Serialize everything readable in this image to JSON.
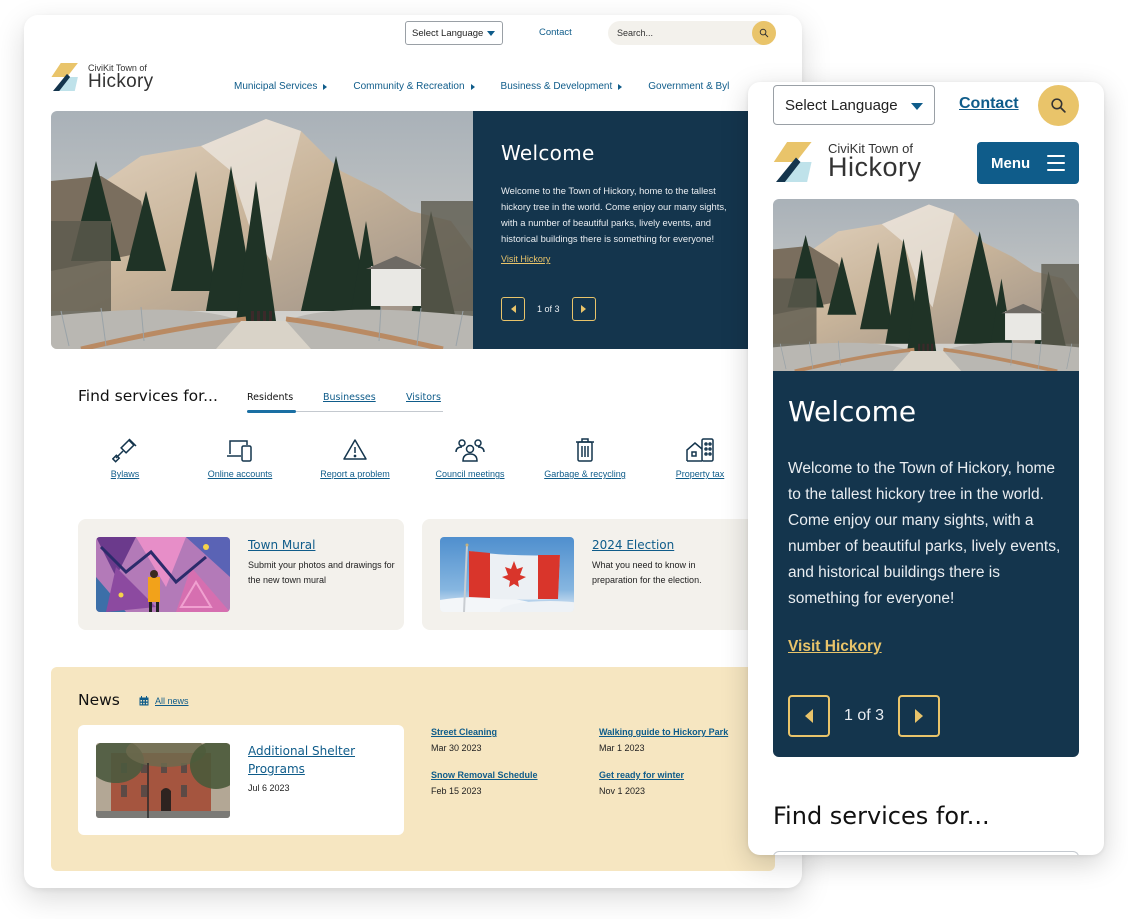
{
  "colors": {
    "brand_blue": "#0f5c8a",
    "navy": "#14354d",
    "gold": "#e9c46a",
    "light_blue": "#bfe2ea",
    "card_bg": "#f3f1ec",
    "news_bg": "#f6e6c1"
  },
  "desktop": {
    "utility": {
      "language_select": "Select Language",
      "contact_link": "Contact",
      "search_placeholder": "Search...",
      "search_icon": "search-icon"
    },
    "logo": {
      "kicker": "CiviKit Town of",
      "name": "Hickory"
    },
    "nav": [
      {
        "label": "Municipal Services"
      },
      {
        "label": "Community & Recreation"
      },
      {
        "label": "Business & Development"
      },
      {
        "label": "Government & Byl"
      }
    ],
    "hero": {
      "title": "Welcome",
      "body": "Welcome to the Town of Hickory, home to the tallest hickory tree in the world.  Come enjoy our many sights, with a number of beautiful parks, lively events, and historical buildings there is something for everyone!",
      "link": "Visit Hickory",
      "pager": "1 of 3",
      "image": "mountain-bridge-photo"
    },
    "find_services": {
      "heading": "Find services for...",
      "tabs": [
        {
          "label": "Residents",
          "active": true
        },
        {
          "label": "Businesses",
          "active": false
        },
        {
          "label": "Visitors",
          "active": false
        }
      ],
      "services": [
        {
          "label": "Bylaws",
          "icon": "gavel-icon"
        },
        {
          "label": "Online accounts",
          "icon": "devices-icon"
        },
        {
          "label": "Report a problem",
          "icon": "warning-icon"
        },
        {
          "label": "Council meetings",
          "icon": "people-icon"
        },
        {
          "label": "Garbage & recycling",
          "icon": "trash-icon"
        },
        {
          "label": "Property tax",
          "icon": "house-building-icon"
        }
      ]
    },
    "features": [
      {
        "title": "Town Mural",
        "desc": "Submit your photos and drawings for the new town mural",
        "image": "mural-photo"
      },
      {
        "title": "2024 Election",
        "desc": "What you need to know in preparation for the election.",
        "image": "canada-flag-photo"
      }
    ],
    "news": {
      "heading": "News",
      "all_news": "All news",
      "featured": {
        "title": "Additional Shelter Programs",
        "date": "Jul 6 2023",
        "image": "brick-building-photo"
      },
      "items": [
        {
          "title": "Street Cleaning",
          "date": "Mar 30 2023"
        },
        {
          "title": "Walking guide to Hickory Park",
          "date": "Mar 1 2023"
        },
        {
          "title": "Snow Removal Schedule",
          "date": "Feb 15 2023"
        },
        {
          "title": "Get ready for winter",
          "date": "Nov 1 2023"
        }
      ]
    }
  },
  "mobile": {
    "language_select": "Select Language",
    "contact_link": "Contact",
    "logo": {
      "kicker": "CiviKit Town of",
      "name": "Hickory"
    },
    "menu_label": "Menu",
    "hero": {
      "title": "Welcome",
      "body": "Welcome to the Town of Hickory, home to the tallest hickory tree in the world. Come enjoy our many sights, with a number of beautiful parks, lively events, and historical buildings there is something for everyone!",
      "link": "Visit Hickory",
      "pager": "1 of 3"
    },
    "find_heading": "Find services for..."
  }
}
